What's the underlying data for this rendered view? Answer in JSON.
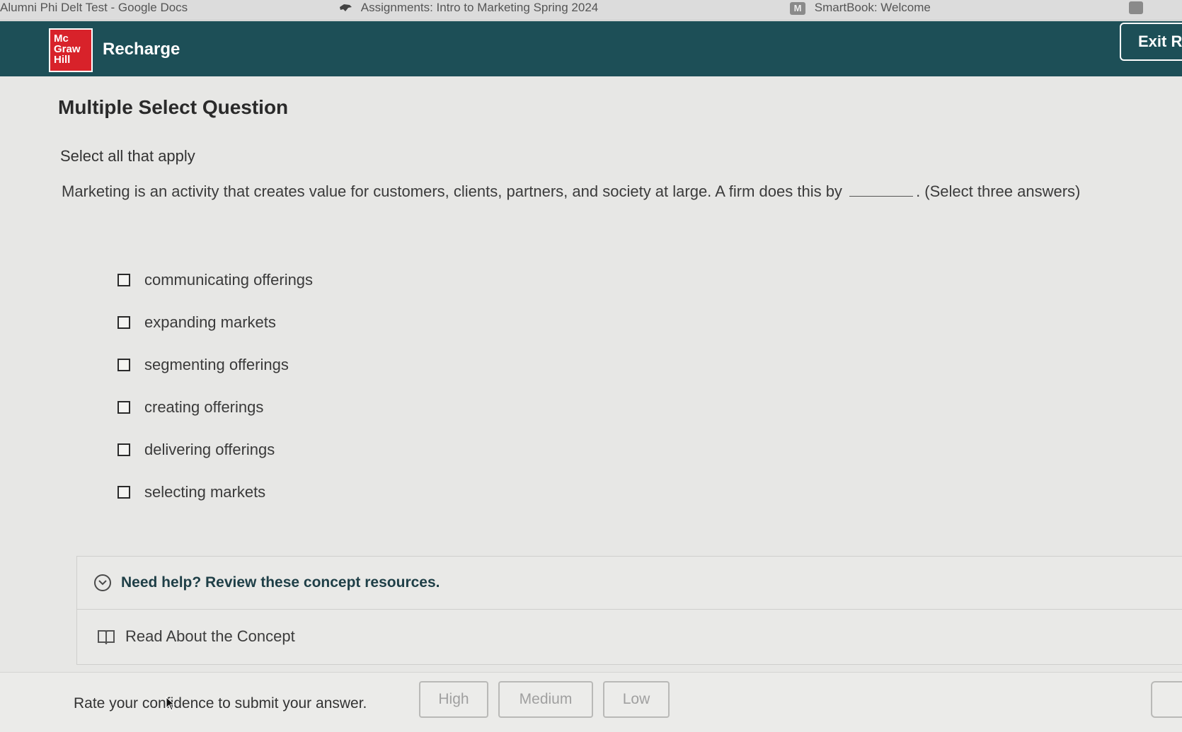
{
  "browser_tabs": [
    {
      "title": "Alumni Phi Delt Test - Google Docs"
    },
    {
      "title": "Assignments: Intro to Marketing Spring 2024"
    },
    {
      "title": "SmartBook: Welcome",
      "badge": "M"
    }
  ],
  "header": {
    "logo_lines": [
      "Mc",
      "Graw",
      "Hill"
    ],
    "app_name": "Recharge",
    "exit_label": "Exit R"
  },
  "question": {
    "title": "Multiple Select Question",
    "instruction": "Select all that apply",
    "prompt_before": "Marketing is an activity that creates value for customers, clients, partners, and society at large. A firm does this by",
    "prompt_after": ". (Select three answers)",
    "options": [
      {
        "label": "communicating offerings"
      },
      {
        "label": "expanding markets"
      },
      {
        "label": "segmenting offerings"
      },
      {
        "label": "creating offerings"
      },
      {
        "label": "delivering offerings"
      },
      {
        "label": "selecting markets"
      }
    ]
  },
  "help": {
    "title": "Need help? Review these concept resources.",
    "resource_label": "Read About the Concept"
  },
  "footer": {
    "rate_label": "Rate your confidence to submit your answer.",
    "high": "High",
    "medium": "Medium",
    "low": "Low"
  },
  "colors": {
    "header_bg": "#1d4f57",
    "logo_red": "#d8222a"
  }
}
